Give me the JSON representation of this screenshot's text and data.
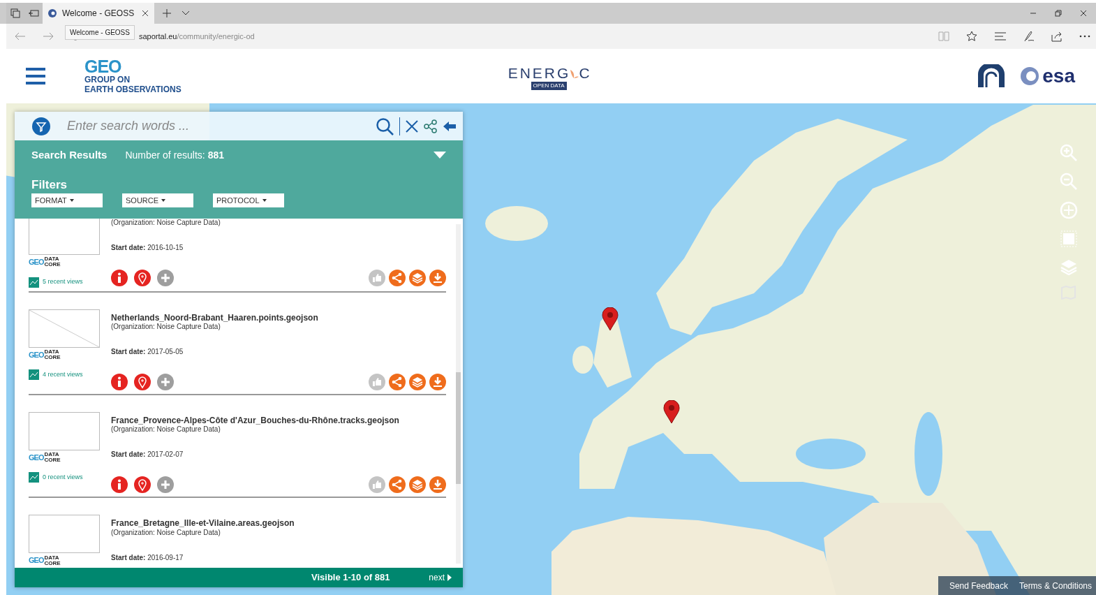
{
  "browser": {
    "tab_title": "Welcome - GEOSS",
    "tooltip": "Welcome - GEOSS",
    "url_host": "saportal.eu",
    "url_path": "/community/energic-od"
  },
  "header": {
    "geo_mark": "GEO",
    "geo_line1": "GROUP ON",
    "geo_line2": "EARTH OBSERVATIONS",
    "energic_left": "ENERG",
    "energic_right": "C",
    "energic_sub": "OPEN DATA",
    "esa": "esa"
  },
  "search": {
    "placeholder": "Enter search words ..."
  },
  "results": {
    "title": "Search Results",
    "count": "Number of results: **881**"
  },
  "filters": {
    "title": "Filters",
    "dropdowns": [
      "FORMAT",
      "SOURCE",
      "PROTOCOL"
    ]
  },
  "items": [
    {
      "organization": "(Organization: Noise Capture Data)",
      "start": "**Start date:** 2016-10-15",
      "provider_mark": "GEO",
      "provider_text": [
        "DATA",
        "CORE"
      ],
      "views": "5 recent views",
      "broken_image": false
    },
    {
      "title": "Netherlands_Noord-Brabant_Haaren.points.geojson",
      "organization": "(Organization: Noise Capture Data)",
      "start": "**Start date:** 2017-05-05",
      "provider_mark": "GEO",
      "provider_text": [
        "DATA",
        "CORE"
      ],
      "views": "4 recent views",
      "broken_image": true
    },
    {
      "title": "France_Provence-Alpes-Côte d'Azur_Bouches-du-Rhône.tracks.geojson",
      "organization": "(Organization: Noise Capture Data)",
      "start": "**Start date:** 2017-02-07",
      "provider_mark": "GEO",
      "provider_text": [
        "DATA",
        "CORE"
      ],
      "views": "0 recent views",
      "broken_image": false
    },
    {
      "title": "France_Bretagne_Ille-et-Vilaine.areas.geojson",
      "organization": "(Organization: Noise Capture Data)",
      "start": "**Start date:** 2016-09-17",
      "provider_mark": "GEO",
      "provider_text": [
        "DATA",
        "CORE"
      ],
      "broken_image": false
    }
  ],
  "pager": {
    "visible": "Visible 1-10 of 881",
    "next": "next"
  },
  "map_footer": [
    "Send Feedback",
    "Terms & Conditions"
  ]
}
